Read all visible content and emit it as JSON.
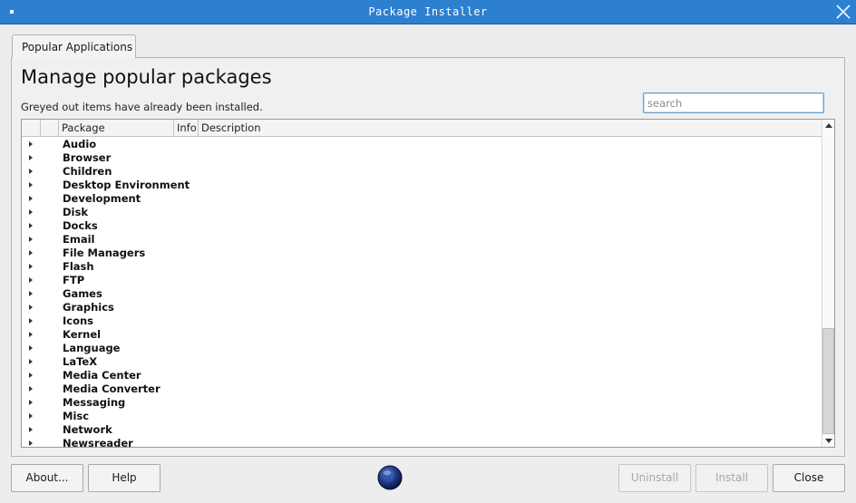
{
  "window": {
    "title": "Package Installer",
    "icons": {
      "menu": "window-menu-icon",
      "close": "close-icon"
    }
  },
  "tabs": [
    {
      "label": "Popular Applications",
      "active": true
    }
  ],
  "main": {
    "heading": "Manage popular packages",
    "subtext": "Greyed out items have already been installed.",
    "search": {
      "placeholder": "search",
      "value": ""
    }
  },
  "tree": {
    "columns": [
      "",
      "",
      "Package",
      "Info",
      "Description"
    ],
    "rows": [
      "Audio",
      "Browser",
      "Children",
      "Desktop Environment",
      "Development",
      "Disk",
      "Docks",
      "Email",
      "File Managers",
      "Flash",
      "FTP",
      "Games",
      "Graphics",
      "Icons",
      "Kernel",
      "Language",
      "LaTeX",
      "Media Center",
      "Media Converter",
      "Messaging",
      "Misc",
      "Network",
      "Newsreader"
    ]
  },
  "buttons": {
    "about": "About...",
    "help": "Help",
    "uninstall": "Uninstall",
    "install": "Install",
    "close": "Close"
  },
  "logo_icon": "globe-icon",
  "colors": {
    "titlebar": "#2d7fcf",
    "accent": "#6e9ec9",
    "disabled_text": "#a8a8a8"
  }
}
